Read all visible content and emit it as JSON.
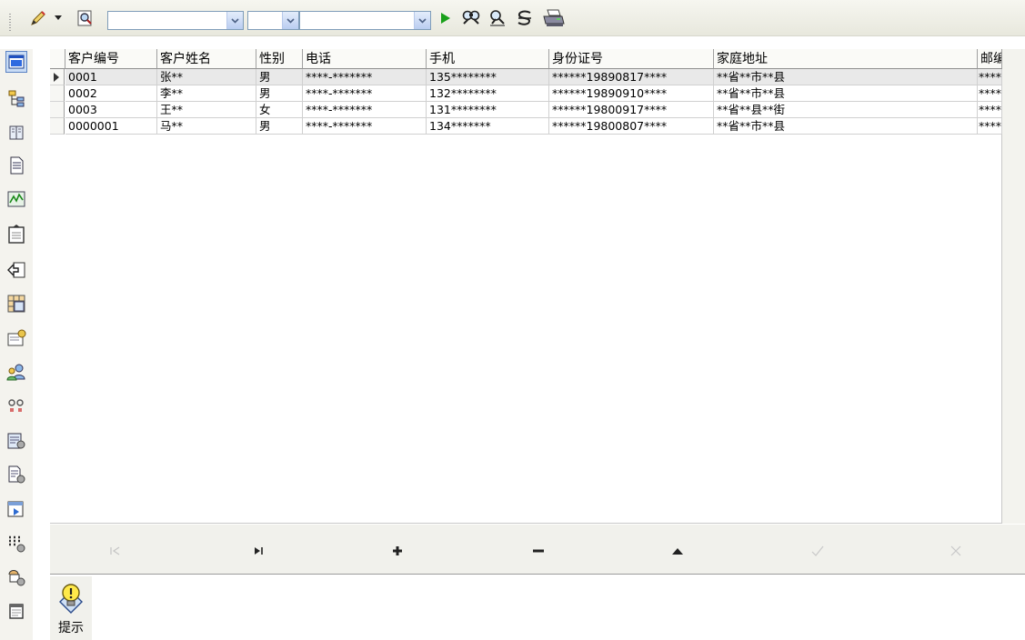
{
  "toolbar": {
    "icons": [
      "pencil-icon",
      "dropdown-arrow-icon",
      "search-doc-icon",
      "play-icon",
      "find-icon",
      "find-next-icon",
      "clear-filter-icon",
      "print-icon"
    ],
    "combos": [
      {
        "name": "field-combo",
        "value": ""
      },
      {
        "name": "operator-combo",
        "value": ""
      },
      {
        "name": "value-combo",
        "value": ""
      }
    ]
  },
  "sidebar": {
    "icons": [
      "window-icon",
      "org-chart-icon",
      "book-icon",
      "document-icon",
      "chart-icon",
      "clipboard-icon",
      "export-icon",
      "table-icon",
      "certificate-icon",
      "users-icon",
      "connect-icon",
      "report-icon",
      "document-settings-icon",
      "import-icon",
      "grid-settings-icon",
      "user-settings-icon",
      "notepad-icon"
    ]
  },
  "grid": {
    "columns": [
      "客户编号",
      "客户姓名",
      "性别",
      "电话",
      "手机",
      "身份证号",
      "家庭地址",
      "邮编"
    ],
    "rows": [
      [
        "0001",
        "张**",
        "男",
        "****-*******",
        "135********",
        "******19890817****",
        "**省**市**县",
        "******"
      ],
      [
        "0002",
        "李**",
        "男",
        "****-*******",
        "132********",
        "******19890910****",
        "**省**市**县",
        "******"
      ],
      [
        "0003",
        "王**",
        "女",
        "****-*******",
        "131********",
        "******19800917****",
        "**省**县**街",
        "******"
      ],
      [
        "0000001",
        "马**",
        "男",
        "****-*******",
        "134*******",
        "******19800807****",
        "**省**市**县",
        "******"
      ]
    ]
  },
  "navigator": {
    "buttons": [
      "first-record-button",
      "last-record-button",
      "add-record-button",
      "delete-record-button",
      "edit-record-button",
      "post-record-button",
      "cancel-record-button"
    ]
  },
  "hint": {
    "label": "提示"
  },
  "colors": {
    "accent_green": "#1aa01a",
    "combo_border": "#7f9db9",
    "grid_line": "#d0d0d0"
  }
}
